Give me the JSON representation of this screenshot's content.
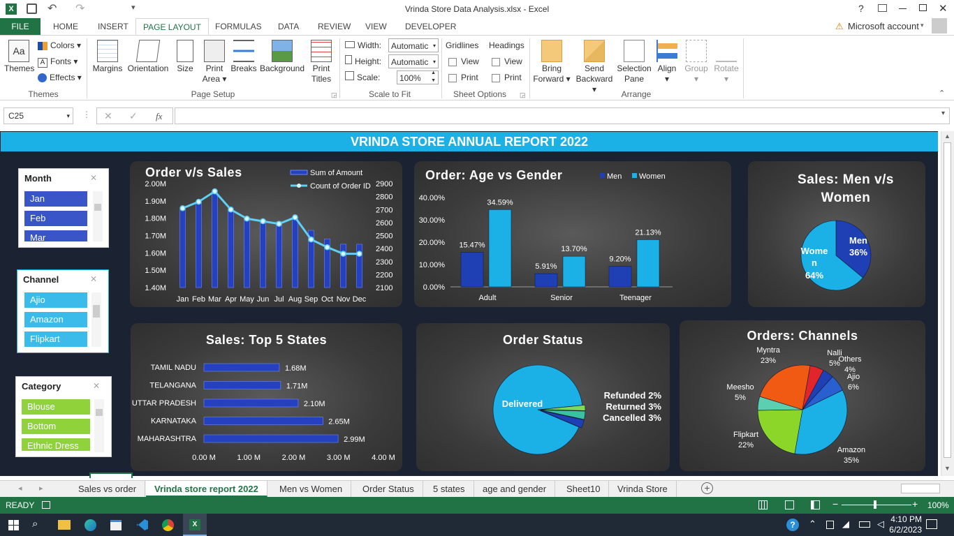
{
  "window": {
    "title": "Vrinda Store Data Analysis.xlsx - Excel",
    "help": "?",
    "account": "Microsoft account"
  },
  "ribbon_tabs": [
    "FILE",
    "HOME",
    "INSERT",
    "PAGE LAYOUT",
    "FORMULAS",
    "DATA",
    "REVIEW",
    "VIEW",
    "DEVELOPER"
  ],
  "ribbon": {
    "themes": {
      "themes": "Themes",
      "colors": "Colors",
      "fonts": "Fonts",
      "effects": "Effects",
      "group": "Themes"
    },
    "page_setup": {
      "margins": "Margins",
      "orientation": "Orientation",
      "size": "Size",
      "print_area": [
        "Print",
        "Area"
      ],
      "breaks": "Breaks",
      "background": "Background",
      "print_titles": [
        "Print",
        "Titles"
      ],
      "group": "Page Setup"
    },
    "scale": {
      "width_label": "Width:",
      "width_value": "Automatic",
      "height_label": "Height:",
      "height_value": "Automatic",
      "scale_label": "Scale:",
      "scale_value": "100%",
      "group": "Scale to Fit"
    },
    "sheet_options": {
      "gridlines": "Gridlines",
      "headings": "Headings",
      "view": "View",
      "print": "Print",
      "group": "Sheet Options"
    },
    "arrange": {
      "bring_forward": [
        "Bring",
        "Forward"
      ],
      "send_backward": [
        "Send",
        "Backward"
      ],
      "selection_pane": [
        "Selection",
        "Pane"
      ],
      "align": "Align",
      "group_btn": "Group",
      "rotate": "Rotate",
      "group": "Arrange"
    }
  },
  "formula_bar": {
    "name_box": "C25",
    "fx": "fx",
    "value": ""
  },
  "report": {
    "banner": "VRINDA STORE ANNUAL REPORT 2022"
  },
  "slicers": {
    "month": {
      "title": "Month",
      "items": [
        "Jan",
        "Feb",
        "Mar"
      ]
    },
    "channel": {
      "title": "Channel",
      "items": [
        "Ajio",
        "Amazon",
        "Flipkart"
      ]
    },
    "category": {
      "title": "Category",
      "items": [
        "Blouse",
        "Bottom",
        "Ethnic Dress"
      ]
    }
  },
  "chart_data": [
    {
      "type": "bar",
      "title": "Order v/s Sales",
      "categories": [
        "Jan",
        "Feb",
        "Mar",
        "Apr",
        "May",
        "Jun",
        "Jul",
        "Aug",
        "Sep",
        "Oct",
        "Nov",
        "Dec"
      ],
      "series": [
        {
          "name": "Sum of Amount",
          "type": "bar",
          "values": [
            1.85,
            1.89,
            1.94,
            1.84,
            1.8,
            1.79,
            1.78,
            1.8,
            1.73,
            1.68,
            1.65,
            1.65
          ]
        },
        {
          "name": "Count of Order ID",
          "type": "line",
          "axis": "right",
          "values": [
            2710,
            2760,
            2840,
            2700,
            2630,
            2610,
            2590,
            2640,
            2470,
            2410,
            2360,
            2360
          ]
        }
      ],
      "y_ticks": [
        "2.00M",
        "1.90M",
        "1.80M",
        "1.70M",
        "1.60M",
        "1.50M",
        "1.40M"
      ],
      "y2_ticks": [
        "2900",
        "2800",
        "2700",
        "2600",
        "2500",
        "2400",
        "2300",
        "2200",
        "2100"
      ],
      "ylim": [
        1.4,
        2.0
      ],
      "y2lim": [
        2100,
        2900
      ],
      "legend": "top-right"
    },
    {
      "type": "bar",
      "title": "Order: Age vs Gender",
      "categories": [
        "Adult",
        "Senior",
        "Teenager"
      ],
      "series": [
        {
          "name": "Men",
          "values": [
            15.47,
            5.91,
            9.2
          ],
          "labels": [
            "15.47%",
            "5.91%",
            "9.20%"
          ],
          "color": "#1f3fb5"
        },
        {
          "name": "Women",
          "values": [
            34.59,
            13.7,
            21.13
          ],
          "labels": [
            "34.59%",
            "13.70%",
            "21.13%"
          ],
          "color": "#1bb1e7"
        }
      ],
      "y_ticks": [
        "40.00%",
        "30.00%",
        "20.00%",
        "10.00%",
        "0.00%"
      ],
      "ylim": [
        0,
        40
      ],
      "legend": "top-right"
    },
    {
      "type": "pie",
      "title": "Sales: Men v/s Women",
      "slices": [
        {
          "name": "Men",
          "value": 36,
          "label": "36%",
          "color": "#1f3fb5"
        },
        {
          "name": "Women",
          "value": 64,
          "label": "64%",
          "color": "#1bb1e7"
        }
      ]
    },
    {
      "type": "bar",
      "orientation": "horizontal",
      "title": "Sales: Top 5 States",
      "categories": [
        "TAMIL NADU",
        "TELANGANA",
        "UTTAR PRADESH",
        "KARNATAKA",
        "MAHARASHTRA"
      ],
      "values": [
        1.68,
        1.71,
        2.1,
        2.65,
        2.99
      ],
      "labels": [
        "1.68M",
        "1.71M",
        "2.10M",
        "2.65M",
        "2.99M"
      ],
      "x_ticks": [
        "0.00 M",
        "1.00 M",
        "2.00 M",
        "3.00 M",
        "4.00 M"
      ],
      "xlim": [
        0,
        4
      ]
    },
    {
      "type": "pie",
      "title": "Order Status",
      "slices": [
        {
          "name": "Delivered",
          "value": 92,
          "label": "Delivered",
          "color": "#1bb1e7"
        },
        {
          "name": "Refunded",
          "value": 2,
          "label": "Refunded 2%",
          "color": "#7fd85a"
        },
        {
          "name": "Returned",
          "value": 3,
          "label": "Returned 3%",
          "color": "#39c2a0"
        },
        {
          "name": "Cancelled",
          "value": 3,
          "label": "Cancelled 3%",
          "color": "#1f3fb5"
        }
      ]
    },
    {
      "type": "pie",
      "title": "Orders: Channels",
      "slices": [
        {
          "name": "Amazon",
          "value": 35,
          "label": "35%",
          "color": "#1bb1e7"
        },
        {
          "name": "Flipkart",
          "value": 22,
          "label": "22%",
          "color": "#8cd62a"
        },
        {
          "name": "Meesho",
          "value": 5,
          "label": "5%",
          "color": "#5ccfb0"
        },
        {
          "name": "Myntra",
          "value": 23,
          "label": "23%",
          "color": "#f05a12"
        },
        {
          "name": "Nalli",
          "value": 5,
          "label": "5%",
          "color": "#e0262a"
        },
        {
          "name": "Others",
          "value": 4,
          "label": "4%",
          "color": "#1f3fb5"
        },
        {
          "name": "Ajio",
          "value": 6,
          "label": "6%",
          "color": "#2a5fd0"
        }
      ]
    }
  ],
  "sheet_tabs": [
    "Sales vs order",
    "Vrinda store report 2022",
    "Men vs Women",
    "Order Status",
    "5 states",
    "age and gender",
    "Sheet10",
    "Vrinda Store"
  ],
  "active_sheet": "Vrinda store report 2022",
  "status": {
    "ready": "READY",
    "zoom": "100%"
  },
  "taskbar": {
    "time": "4:10 PM",
    "date": "6/2/2023"
  },
  "colors": {
    "excel_green": "#217346",
    "banner": "#1bb1e7",
    "dark_blue": "#1f3fb5",
    "sheet_bg": "#1b2231"
  }
}
